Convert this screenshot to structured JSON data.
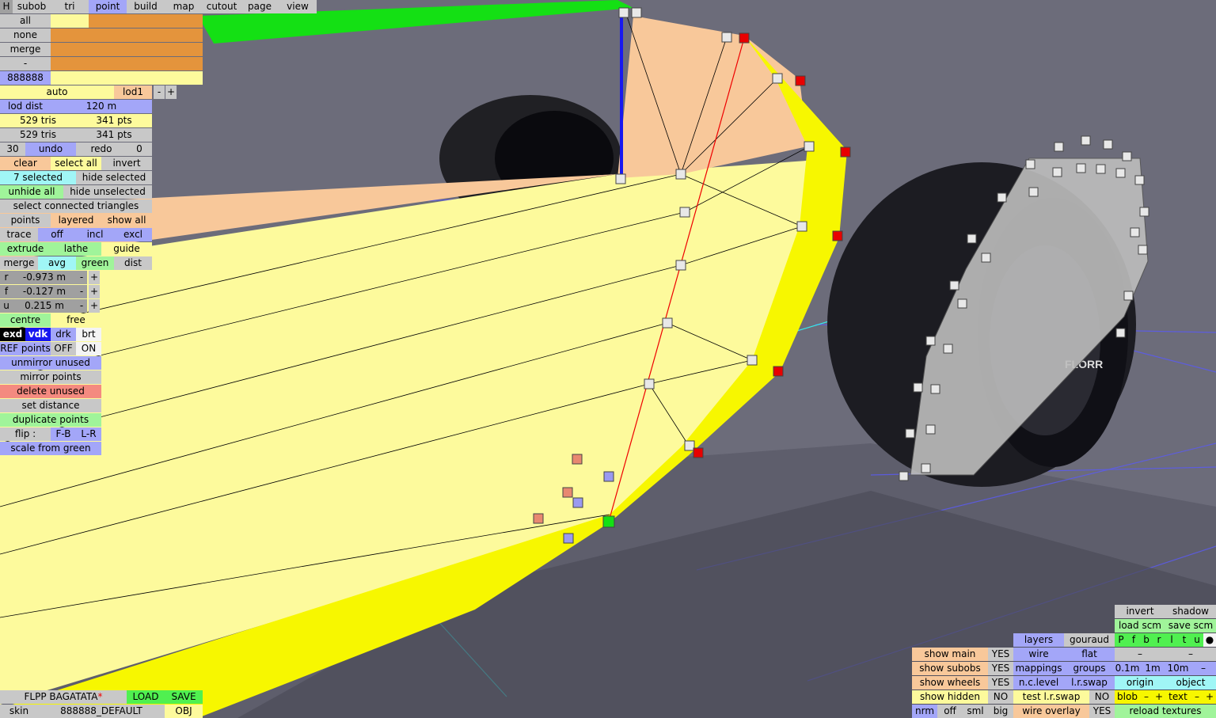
{
  "menu": {
    "h": "H",
    "tabs": [
      "subob",
      "tri",
      "point",
      "build",
      "map",
      "cutout",
      "page",
      "view"
    ],
    "active": "point"
  },
  "select": {
    "all": "all",
    "none": "none",
    "merge": "merge",
    "dash": "-",
    "code": "888888"
  },
  "lod": {
    "auto": "auto",
    "name": "lod1",
    "minus": "-",
    "plus": "+",
    "dist_label": "lod dist",
    "dist_value": "120 m"
  },
  "stats": {
    "tris1": "529 tris",
    "pts1": "341 pts",
    "tris2": "529 tris",
    "pts2": "341 pts"
  },
  "undo_row": {
    "count": "30",
    "undo": "undo",
    "redo": "redo",
    "redo_count": "0"
  },
  "sel_row": {
    "clear": "clear",
    "select_all": "select all",
    "invert": "invert"
  },
  "sel_row2": {
    "selected": "7 selected",
    "hide_selected": "hide selected"
  },
  "sel_row3": {
    "unhide_all": "unhide all",
    "hide_unselected": "hide unselected"
  },
  "connected": "select connected triangles",
  "points_row": {
    "points": "points",
    "layered": "layered",
    "show_all": "show all"
  },
  "trace_row": {
    "trace": "trace",
    "off": "off",
    "incl": "incl",
    "excl": "excl"
  },
  "extrude_row": {
    "extrude": "extrude",
    "lathe": "lathe",
    "guide": "guide"
  },
  "merge_row": {
    "merge": "merge",
    "avg": "avg",
    "green": "green",
    "dist": "dist"
  },
  "coords": [
    {
      "axis": "r",
      "value": "-0.973 m",
      "minus": "-",
      "plus": "+"
    },
    {
      "axis": "f",
      "value": "-0.127 m",
      "minus": "-",
      "plus": "+"
    },
    {
      "axis": "u",
      "value": "0.215 m",
      "minus": "-",
      "plus": "+"
    }
  ],
  "centre_row": {
    "centre": "centre",
    "free": "free"
  },
  "shade_row": {
    "exd": "exd",
    "vdk": "vdk",
    "drk": "drk",
    "brt": "brt"
  },
  "ref_row": {
    "ref": "REF points",
    "off": "OFF",
    "on": "ON"
  },
  "actions": {
    "unmirror": "unmirror unused",
    "mirror": "mirror points",
    "delete": "delete unused",
    "set_distance": "set distance",
    "duplicate": "duplicate points"
  },
  "flip_row": {
    "flip": "flip :",
    "fb": "F-B",
    "lr": "L-R"
  },
  "scale": "scale from green",
  "bottom_left": {
    "name": "FLPP BAGATATA",
    "asterisk": "*",
    "load": "LOAD",
    "save": "SAVE",
    "skin": "skin",
    "skin_value": "888888_DEFAULT",
    "obj": "OBJ"
  },
  "bottom_right": {
    "invert": "invert",
    "shadow": "shadow",
    "load_scm": "load scm",
    "save_scm": "save scm",
    "pfb": [
      "P",
      "f",
      "b",
      "r",
      "l",
      "t",
      "u",
      "●"
    ],
    "layers": "layers",
    "gouraud": "gouraud",
    "dash1": "–",
    "dash2": "–",
    "show_main": "show main",
    "show_main_val": "YES",
    "wire": "wire",
    "flat": "flat",
    "show_subobs": "show subobs",
    "show_subobs_val": "YES",
    "mappings": "mappings",
    "groups": "groups",
    "grid": [
      "0.1m",
      "1m",
      "10m",
      "–"
    ],
    "show_wheels": "show wheels",
    "show_wheels_val": "YES",
    "nc_level": "n.c.level",
    "lr_swap": "l.r.swap",
    "origin": "origin",
    "object": "object",
    "show_hidden": "show hidden",
    "show_hidden_val": "NO",
    "test_lr_swap": "test l.r.swap",
    "test_val": "NO",
    "blob": "blob",
    "blob_minus": "–",
    "blob_plus": "+",
    "text": "text",
    "text_minus": "–",
    "text_plus": "+",
    "nrm": "nrm",
    "off": "off",
    "sml": "sml",
    "big": "big",
    "wire_overlay": "wire overlay",
    "wire_overlay_val": "YES",
    "reload": "reload textures"
  },
  "colors": {
    "background": "#6c6c7a",
    "panel_yellow": "#fdfa9c",
    "panel_peach": "#f8c89a",
    "selected_point": "#e80000"
  }
}
